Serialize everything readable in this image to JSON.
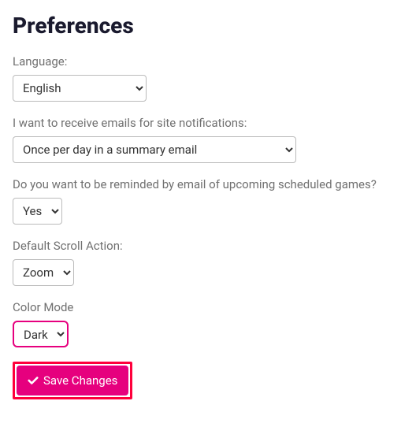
{
  "title": "Preferences",
  "fields": {
    "language": {
      "label": "Language:",
      "value": "English"
    },
    "emails": {
      "label": "I want to receive emails for site notifications:",
      "value": "Once per day in a summary email"
    },
    "reminders": {
      "label": "Do you want to be reminded by email of upcoming scheduled games?",
      "value": "Yes"
    },
    "scroll": {
      "label": "Default Scroll Action:",
      "value": "Zoom"
    },
    "colorMode": {
      "label": "Color Mode",
      "value": "Dark"
    }
  },
  "buttons": {
    "save": "Save Changes"
  }
}
